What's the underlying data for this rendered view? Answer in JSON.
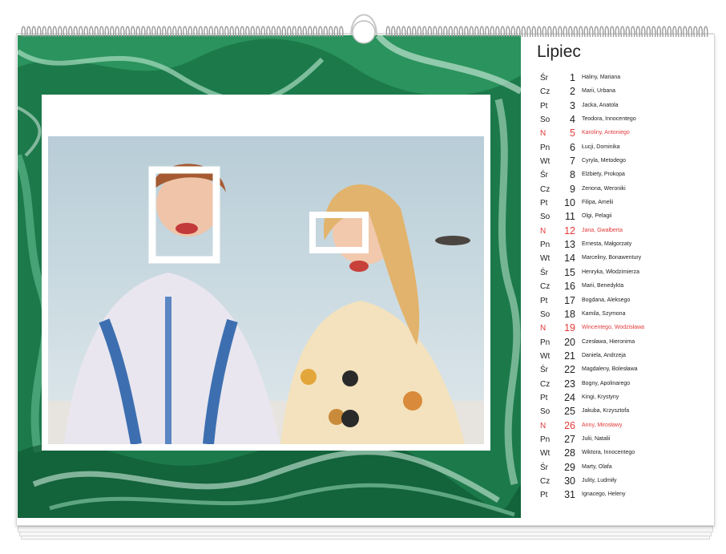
{
  "calendar": {
    "month": "Lipiec",
    "colors": {
      "sunday": "#e23a3a",
      "background_art": "#1c7a4a"
    },
    "days": [
      {
        "weekday": "Śr",
        "day": "1",
        "names": "Haliny, Mariana"
      },
      {
        "weekday": "Cz",
        "day": "2",
        "names": "Marii, Urbana"
      },
      {
        "weekday": "Pt",
        "day": "3",
        "names": "Jacka, Anatola"
      },
      {
        "weekday": "So",
        "day": "4",
        "names": "Teodora, Innocentego"
      },
      {
        "weekday": "N",
        "day": "5",
        "names": "Karoliny, Antoniego",
        "sunday": true
      },
      {
        "weekday": "Pn",
        "day": "6",
        "names": "Łucji, Dominika"
      },
      {
        "weekday": "Wt",
        "day": "7",
        "names": "Cyryla, Metodego"
      },
      {
        "weekday": "Śr",
        "day": "8",
        "names": "Elżbiety, Prokopa"
      },
      {
        "weekday": "Cz",
        "day": "9",
        "names": "Zenona, Weroniki"
      },
      {
        "weekday": "Pt",
        "day": "10",
        "names": "Filipa, Amelii"
      },
      {
        "weekday": "So",
        "day": "11",
        "names": "Olgi, Pelagii"
      },
      {
        "weekday": "N",
        "day": "12",
        "names": "Jana, Gwalberta",
        "sunday": true
      },
      {
        "weekday": "Pn",
        "day": "13",
        "names": "Ernesta, Małgorzaty"
      },
      {
        "weekday": "Wt",
        "day": "14",
        "names": "Marceliny, Bonawentury"
      },
      {
        "weekday": "Śr",
        "day": "15",
        "names": "Henryka, Włodzimierza"
      },
      {
        "weekday": "Cz",
        "day": "16",
        "names": "Marii, Benedykta"
      },
      {
        "weekday": "Pt",
        "day": "17",
        "names": "Bogdana, Aleksego"
      },
      {
        "weekday": "So",
        "day": "18",
        "names": "Kamila, Szymona"
      },
      {
        "weekday": "N",
        "day": "19",
        "names": "Wincentego, Wodzisława",
        "sunday": true
      },
      {
        "weekday": "Pn",
        "day": "20",
        "names": "Czesława, Hieronima"
      },
      {
        "weekday": "Wt",
        "day": "21",
        "names": "Daniela, Andrzeja"
      },
      {
        "weekday": "Śr",
        "day": "22",
        "names": "Magdaleny, Bolesława"
      },
      {
        "weekday": "Cz",
        "day": "23",
        "names": "Bogny, Apolinarego"
      },
      {
        "weekday": "Pt",
        "day": "24",
        "names": "Kingi, Krystyny"
      },
      {
        "weekday": "So",
        "day": "25",
        "names": "Jakuba, Krzysztofa"
      },
      {
        "weekday": "N",
        "day": "26",
        "names": "Anny, Mirosławy",
        "sunday": true
      },
      {
        "weekday": "Pn",
        "day": "27",
        "names": "Julii, Natalii"
      },
      {
        "weekday": "Wt",
        "day": "28",
        "names": "Wiktora, Innocentego"
      },
      {
        "weekday": "Śr",
        "day": "29",
        "names": "Marty, Olafa"
      },
      {
        "weekday": "Cz",
        "day": "30",
        "names": "Julity, Ludmiły"
      },
      {
        "weekday": "Pt",
        "day": "31",
        "names": "Ignacego, Heleny"
      }
    ]
  }
}
